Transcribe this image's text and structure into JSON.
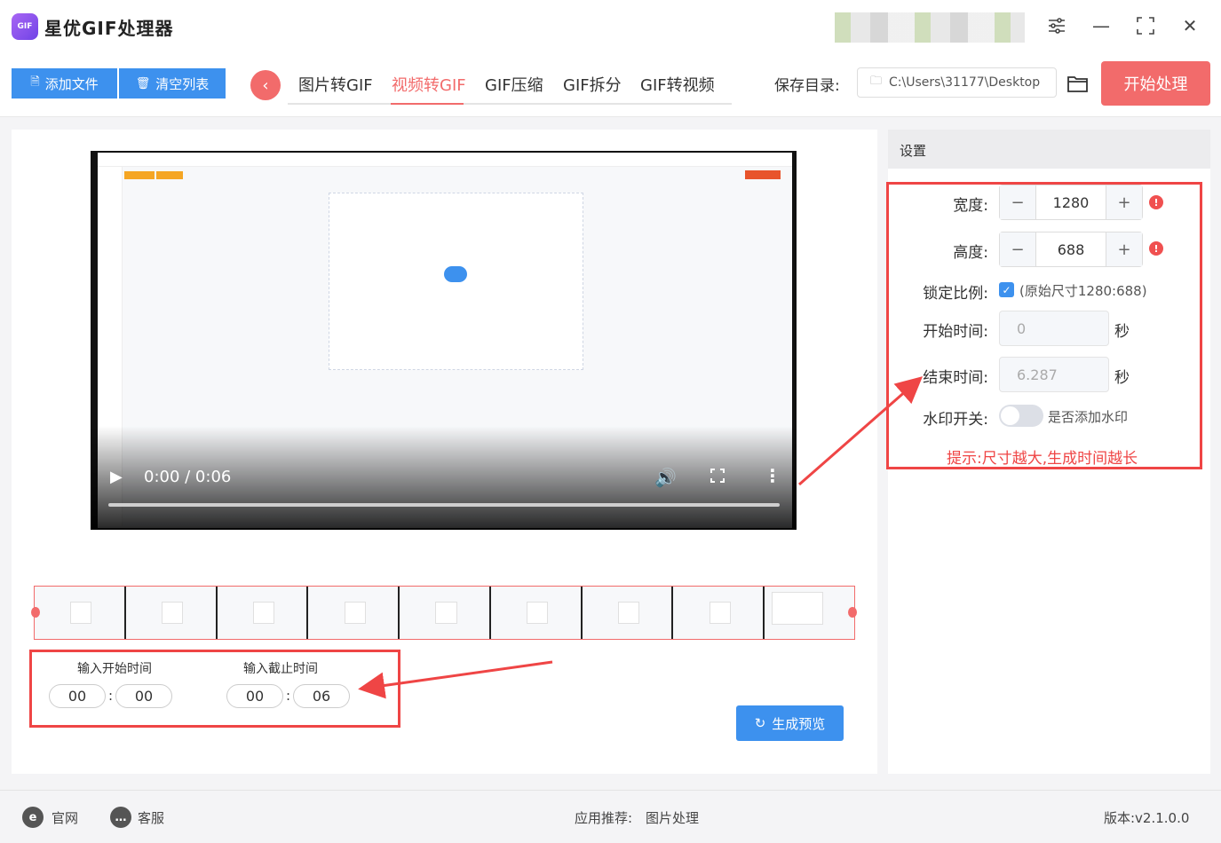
{
  "app": {
    "logo_text": "GIF",
    "title": "星优GIF处理器"
  },
  "window": {
    "settings_icon": "sliders-icon",
    "minimize": "—",
    "maximize": "⛶",
    "close": "✕"
  },
  "toolbar": {
    "add_file_label": "添加文件",
    "clear_list_label": "清空列表",
    "back_glyph": "‹",
    "tabs": [
      "图片转GIF",
      "视频转GIF",
      "GIF压缩",
      "GIF拆分",
      "GIF转视频"
    ],
    "active_tab": "视频转GIF",
    "save_dir_label": "保存目录:",
    "save_dir_value": "C:\\Users\\31177\\Desktop",
    "start_label": "开始处理"
  },
  "player": {
    "time_display": "0:00 / 0:06",
    "progress": 0
  },
  "trim": {
    "start_label": "输入开始时间",
    "end_label": "输入截止时间",
    "start_min": "00",
    "start_sec": "00",
    "end_min": "00",
    "end_sec": "06",
    "separator": ":",
    "preview_label": "生成预览"
  },
  "settings": {
    "header": "设置",
    "width_label": "宽度:",
    "width_value": "1280",
    "height_label": "高度:",
    "height_value": "688",
    "minus": "−",
    "plus": "+",
    "warn_glyph": "!",
    "lock_label": "锁定比例:",
    "lock_checked": true,
    "lock_text": "(原始尺寸1280:688)",
    "start_time_label": "开始时间:",
    "start_time_value": "0",
    "end_time_label": "结束时间:",
    "end_time_value": "6.287",
    "unit": "秒",
    "watermark_label": "水印开关:",
    "watermark_on": false,
    "watermark_text": "是否添加水印",
    "hint": "提示:尺寸越大,生成时间越长"
  },
  "footer": {
    "website_label": "官网",
    "support_label": "客服",
    "recommend_label": "应用推荐:",
    "recommend_value": "图片处理",
    "version": "版本:v2.1.0.0"
  },
  "colors": {
    "accent_red": "#f26b6b",
    "accent_blue": "#3d91ee",
    "annotation_red": "#ef4545"
  }
}
